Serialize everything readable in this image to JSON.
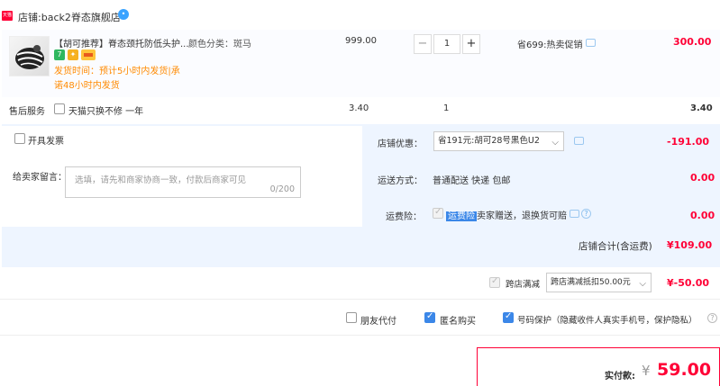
{
  "shop": {
    "badge": "天猫",
    "label": "店铺:",
    "name": "back2脊态旗舰店",
    "wangwang_icon": "chat-bubble-icon"
  },
  "item": {
    "title": "【胡可推荐】脊态颈托防低头护...",
    "attr": "颜色分类：斑马",
    "ship_time": "发货时间：预计5小时内发货|承",
    "ship_time2": "诺48小时内发货",
    "price": "999.00",
    "quantity": "1",
    "minus": "−",
    "plus": "+",
    "promo": "省699:热卖促销",
    "subtotal": "300.00"
  },
  "service": {
    "label": "售后服务",
    "option": "天猫只换不修 一年",
    "price": "3.40",
    "qty": "1",
    "total": "3.40"
  },
  "invoice": {
    "label": "开具发票"
  },
  "shop_discount": {
    "label": "店铺优惠：",
    "selected": "省191元:胡可28号黑色U2",
    "amount": "-191.00"
  },
  "message": {
    "label": "给卖家留言：",
    "placeholder": "选填，请先和商家协商一致，付款后商家可见",
    "counter": "0/200"
  },
  "shipping": {
    "label": "运送方式：",
    "value": "普通配送 快递 包邮",
    "amount": "0.00"
  },
  "insurance": {
    "label": "运费险：",
    "tag": "运费险",
    "text": "卖家赠送，退换货可赔",
    "amount": "0.00"
  },
  "shop_total": {
    "label": "店铺合计(含运费)",
    "amount": "¥109.00"
  },
  "cross_shop": {
    "label": "跨店满减",
    "selected": "跨店满减抵扣50.00元",
    "amount": "¥-50.00"
  },
  "options": {
    "friend_pay": "朋友代付",
    "anonymous": "匿名购买",
    "number_protect": "号码保护（隐藏收件人真实手机号，保护隐私）"
  },
  "payment": {
    "label": "实付款:",
    "currency": "¥",
    "amount": "59.00"
  },
  "colors": {
    "accent_red": "#ff0036",
    "brand_blue": "#3b87e8",
    "orange": "#ff8a00"
  }
}
